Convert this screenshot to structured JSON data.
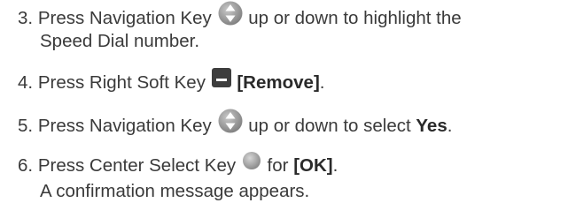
{
  "steps": [
    {
      "number": "3.",
      "before": "Press Navigation Key",
      "icon": "navigation-key-icon",
      "after": "up or down to highlight the",
      "line2": "Speed Dial number."
    },
    {
      "number": "4.",
      "before": "Press Right Soft Key",
      "icon": "right-soft-key-icon",
      "bold": "[Remove]",
      "end": "."
    },
    {
      "number": "5.",
      "before": "Press Navigation Key",
      "icon": "navigation-key-icon",
      "after": "up or down to select",
      "bold": "Yes",
      "end": "."
    },
    {
      "number": "6.",
      "before": "Press Center Select Key",
      "icon": "center-select-key-icon",
      "after": "for",
      "bold": "[OK]",
      "end": ".",
      "line2": "A confirmation message appears."
    }
  ],
  "colors": {
    "text": "#3a3a3a",
    "key_gray": "#8c8c8c",
    "soft_key": "#3d3d3d"
  }
}
